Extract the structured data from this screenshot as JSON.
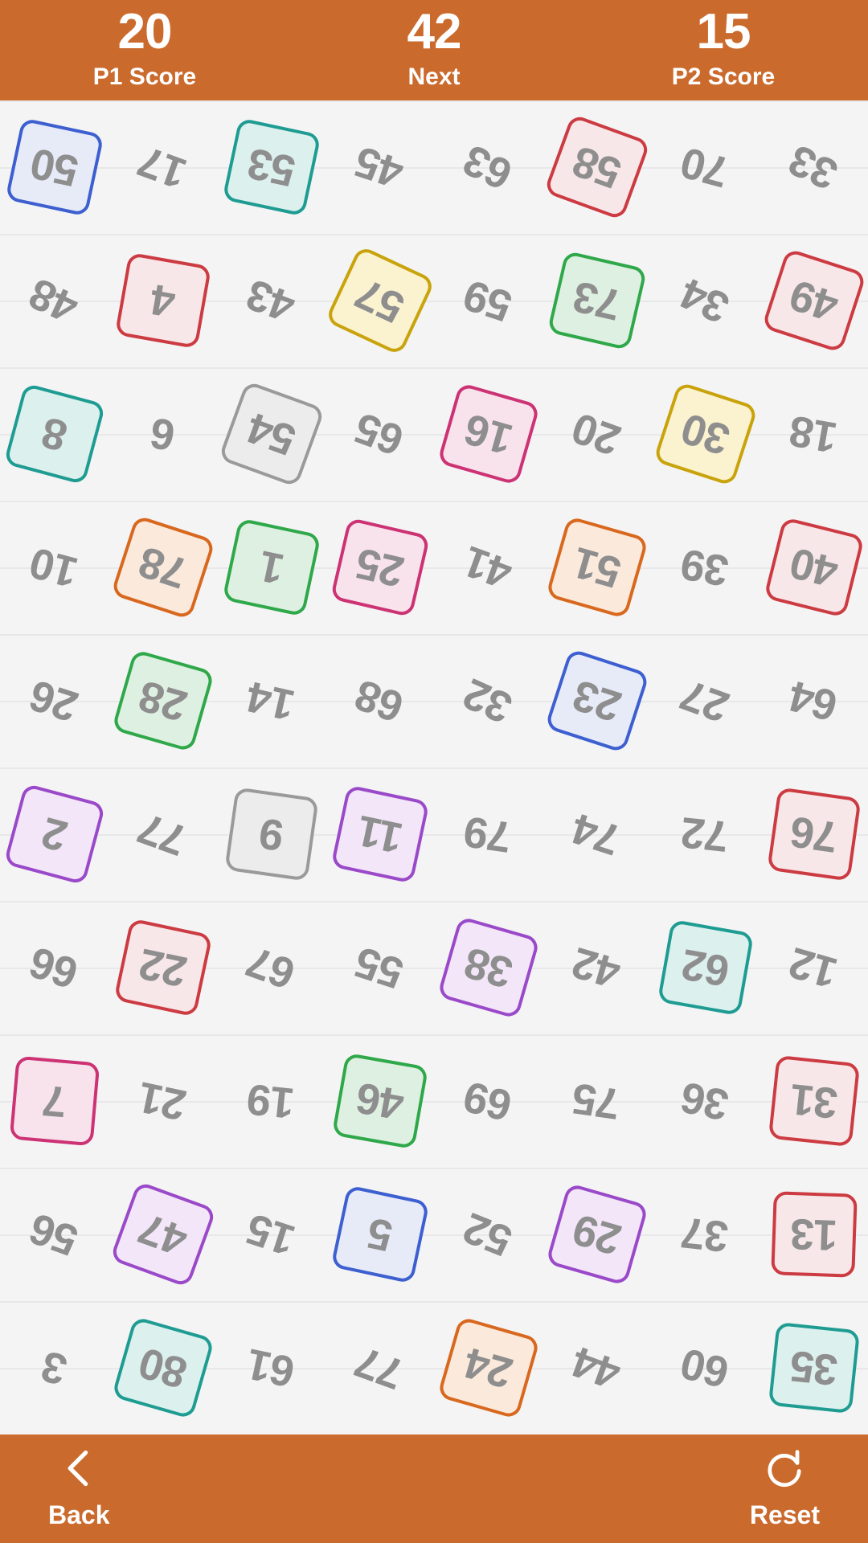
{
  "header": {
    "p1": {
      "value": "20",
      "label": "P1 Score"
    },
    "next": {
      "value": "42",
      "label": "Next"
    },
    "p2": {
      "value": "15",
      "label": "P2 Score"
    }
  },
  "footer": {
    "back": {
      "label": "Back",
      "icon": "chevron-left-icon"
    },
    "reset": {
      "label": "Reset",
      "icon": "refresh-icon"
    }
  },
  "colors": {
    "header_bg": "#cb6a2d",
    "footer_bg": "#cb6a2d",
    "board_bg": "#f4f4f5",
    "rule_line": "#e8e8ea",
    "number_text": "#8e8e8e",
    "blue": "#3d5fd0",
    "teal": "#1f9c92",
    "red": "#cc3b42",
    "yellow": "#c9a30b",
    "green": "#2fa84a",
    "pink": "#cc3274",
    "orange": "#d9681f",
    "purple": "#9a49c9",
    "gray": "#9a9a9a"
  },
  "board": {
    "rows": 10,
    "cols": 8,
    "cells": [
      [
        {
          "num": "50",
          "tile": "blue",
          "rot": 192
        },
        {
          "num": "17",
          "tile": null,
          "rot": 200
        },
        {
          "num": "53",
          "tile": "teal",
          "rot": 192
        },
        {
          "num": "45",
          "tile": null,
          "rot": 198
        },
        {
          "num": "63",
          "tile": null,
          "rot": 205
        },
        {
          "num": "58",
          "tile": "red",
          "rot": 200
        },
        {
          "num": "70",
          "tile": null,
          "rot": 195
        },
        {
          "num": "33",
          "tile": null,
          "rot": 205
        }
      ],
      [
        {
          "num": "48",
          "tile": null,
          "rot": 205
        },
        {
          "num": "4",
          "tile": "red",
          "rot": 190
        },
        {
          "num": "43",
          "tile": null,
          "rot": 200
        },
        {
          "num": "57",
          "tile": "yellow",
          "rot": 205
        },
        {
          "num": "59",
          "tile": null,
          "rot": 198
        },
        {
          "num": "73",
          "tile": "green",
          "rot": 193
        },
        {
          "num": "34",
          "tile": null,
          "rot": 205
        },
        {
          "num": "49",
          "tile": "red",
          "rot": 198
        }
      ],
      [
        {
          "num": "8",
          "tile": "teal",
          "rot": 195
        },
        {
          "num": "6",
          "tile": null,
          "rot": 190
        },
        {
          "num": "54",
          "tile": "gray",
          "rot": 200
        },
        {
          "num": "65",
          "tile": null,
          "rot": 200
        },
        {
          "num": "16",
          "tile": "pink",
          "rot": 196
        },
        {
          "num": "20",
          "tile": null,
          "rot": 200
        },
        {
          "num": "30",
          "tile": "yellow",
          "rot": 198
        },
        {
          "num": "18",
          "tile": null,
          "rot": 190
        }
      ],
      [
        {
          "num": "10",
          "tile": null,
          "rot": 195
        },
        {
          "num": "78",
          "tile": "orange",
          "rot": 198
        },
        {
          "num": "1",
          "tile": "green",
          "rot": 192
        },
        {
          "num": "25",
          "tile": "pink",
          "rot": 193
        },
        {
          "num": "41",
          "tile": null,
          "rot": 200
        },
        {
          "num": "51",
          "tile": "orange",
          "rot": 196
        },
        {
          "num": "39",
          "tile": null,
          "rot": 190
        },
        {
          "num": "40",
          "tile": "red",
          "rot": 194
        }
      ],
      [
        {
          "num": "26",
          "tile": null,
          "rot": 198
        },
        {
          "num": "28",
          "tile": "green",
          "rot": 196
        },
        {
          "num": "14",
          "tile": null,
          "rot": 193
        },
        {
          "num": "68",
          "tile": null,
          "rot": 200
        },
        {
          "num": "32",
          "tile": null,
          "rot": 204
        },
        {
          "num": "23",
          "tile": "blue",
          "rot": 198
        },
        {
          "num": "27",
          "tile": null,
          "rot": 200
        },
        {
          "num": "64",
          "tile": null,
          "rot": 195
        }
      ],
      [
        {
          "num": "2",
          "tile": "purple",
          "rot": 195
        },
        {
          "num": "77",
          "tile": null,
          "rot": 200
        },
        {
          "num": "9",
          "tile": "gray",
          "rot": 188
        },
        {
          "num": "11",
          "tile": "purple",
          "rot": 192
        },
        {
          "num": "79",
          "tile": null,
          "rot": 188
        },
        {
          "num": "74",
          "tile": null,
          "rot": 198
        },
        {
          "num": "72",
          "tile": null,
          "rot": 186
        },
        {
          "num": "76",
          "tile": "red",
          "rot": 188
        }
      ],
      [
        {
          "num": "66",
          "tile": null,
          "rot": 198
        },
        {
          "num": "22",
          "tile": "red",
          "rot": 192
        },
        {
          "num": "67",
          "tile": null,
          "rot": 200
        },
        {
          "num": "55",
          "tile": null,
          "rot": 198
        },
        {
          "num": "38",
          "tile": "purple",
          "rot": 196
        },
        {
          "num": "42",
          "tile": null,
          "rot": 196
        },
        {
          "num": "62",
          "tile": "teal",
          "rot": 190
        },
        {
          "num": "12",
          "tile": null,
          "rot": 196
        }
      ],
      [
        {
          "num": "7",
          "tile": "pink",
          "rot": 185
        },
        {
          "num": "21",
          "tile": null,
          "rot": 192
        },
        {
          "num": "19",
          "tile": null,
          "rot": 186
        },
        {
          "num": "46",
          "tile": "green",
          "rot": 190
        },
        {
          "num": "69",
          "tile": null,
          "rot": 194
        },
        {
          "num": "75",
          "tile": null,
          "rot": 188
        },
        {
          "num": "36",
          "tile": null,
          "rot": 192
        },
        {
          "num": "31",
          "tile": "red",
          "rot": 186
        }
      ],
      [
        {
          "num": "56",
          "tile": null,
          "rot": 200
        },
        {
          "num": "47",
          "tile": "purple",
          "rot": 200
        },
        {
          "num": "15",
          "tile": null,
          "rot": 198
        },
        {
          "num": "5",
          "tile": "blue",
          "rot": 192
        },
        {
          "num": "52",
          "tile": null,
          "rot": 202
        },
        {
          "num": "29",
          "tile": "purple",
          "rot": 196
        },
        {
          "num": "37",
          "tile": null,
          "rot": 186
        },
        {
          "num": "13",
          "tile": "red",
          "rot": 182
        }
      ],
      [
        {
          "num": "3",
          "tile": null,
          "rot": 196
        },
        {
          "num": "80",
          "tile": "teal",
          "rot": 196
        },
        {
          "num": "61",
          "tile": null,
          "rot": 192
        },
        {
          "num": "77",
          "tile": null,
          "rot": 200
        },
        {
          "num": "24",
          "tile": "orange",
          "rot": 196
        },
        {
          "num": "44",
          "tile": null,
          "rot": 200
        },
        {
          "num": "60",
          "tile": null,
          "rot": 194
        },
        {
          "num": "35",
          "tile": "teal",
          "rot": 186
        }
      ]
    ]
  }
}
